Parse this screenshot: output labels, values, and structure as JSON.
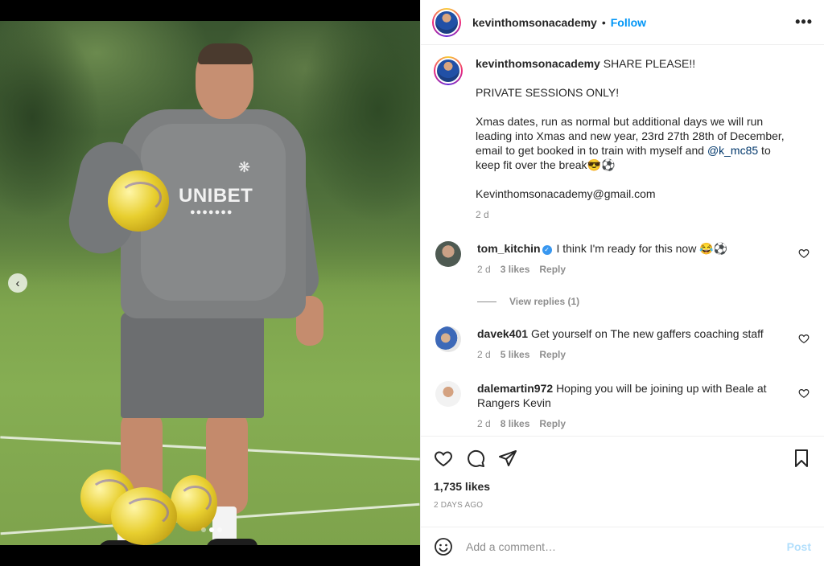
{
  "post": {
    "author": "kevinthomsonacademy",
    "follow_label": "Follow",
    "more_label": "•••",
    "separator": "•"
  },
  "media": {
    "jersey_text": "UNIBET",
    "jersey_dots": "●●●●●●●",
    "prev_label": "‹",
    "slide_count": 3,
    "active_slide": 2
  },
  "caption": {
    "username": "kevinthomsonacademy",
    "line1": "SHARE PLEASE!!",
    "line2": "PRIVATE SESSIONS ONLY!",
    "line3_pre": "Xmas dates, run as normal but additional days we will run leading into Xmas and new year, 23rd 27th 28th of December, email to get booked in to train with myself and ",
    "mention": "@k_mc85",
    "line3_post": " to keep fit over the break😎⚽",
    "email": "Kevinthomsonacademy@gmail.com",
    "time": "2 d"
  },
  "comments": [
    {
      "username": "tom_kitchin",
      "verified": true,
      "text": "I think I'm ready for this now 😂⚽",
      "time": "2 d",
      "likes": "3 likes",
      "reply": "Reply"
    },
    {
      "username": "davek401",
      "verified": false,
      "text": "Get yourself on The new gaffers coaching staff",
      "time": "2 d",
      "likes": "5 likes",
      "reply": "Reply"
    },
    {
      "username": "dalemartin972",
      "verified": false,
      "text": "Hoping you will be joining up with Beale at Rangers Kevin",
      "time": "2 d",
      "likes": "8 likes",
      "reply": "Reply"
    }
  ],
  "view_replies": "View replies (1)",
  "actions": {
    "likes": "1,735 likes",
    "date": "2 DAYS AGO"
  },
  "add_comment": {
    "placeholder": "Add a comment…",
    "post_label": "Post"
  },
  "colors": {
    "accent": "#0095f6",
    "post_disabled": "#b2dffc",
    "muted": "#8e8e8e",
    "text": "#262626"
  },
  "icons": [
    "more-icon",
    "chevron-left-icon",
    "heart-icon",
    "comment-icon",
    "share-icon",
    "bookmark-icon",
    "emoji-icon",
    "verified-icon"
  ]
}
